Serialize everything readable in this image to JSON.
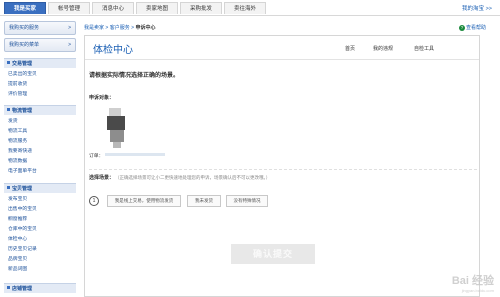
{
  "topnav": {
    "tabs": [
      {
        "label": "我是买家",
        "active": true
      },
      {
        "label": "帐号管理",
        "active": false
      },
      {
        "label": "消息中心",
        "active": false
      },
      {
        "label": "卖家地图",
        "active": false
      },
      {
        "label": "采购批发",
        "active": false
      },
      {
        "label": "卖往海外",
        "active": false
      }
    ],
    "mytaobao": "我的淘宝 >>"
  },
  "sidebar": {
    "buttons": [
      {
        "label": "我购买的服务",
        "arrow": ">"
      },
      {
        "label": "我购买的菜单",
        "arrow": ">"
      }
    ],
    "sections": [
      {
        "title": "交易管理",
        "items": [
          "已卖出的宝贝",
          "提前收货",
          "评价管理"
        ]
      },
      {
        "title": "物流管理",
        "items": [
          "发货",
          "物流工具",
          "物流服务",
          "我要寄快递",
          "物流数据",
          "电子面单平台"
        ]
      },
      {
        "title": "宝贝管理",
        "items": [
          "发布宝贝",
          "出售中的宝贝",
          "橱窗推荐",
          "仓库中的宝贝",
          "体检中心",
          "历史宝贝记录",
          "品牌宝贝",
          "新品词图"
        ]
      },
      {
        "title": "店铺管理",
        "items": []
      }
    ]
  },
  "breadcrumb": {
    "items": [
      "我是卖家",
      "客户服务",
      "申诉中心"
    ],
    "separator": ">"
  },
  "help": {
    "icon": "question-circle-icon",
    "label": "查看帮助"
  },
  "panel": {
    "title": "体检中心",
    "tabs": [
      "首页",
      "我的违规",
      "自检工具"
    ]
  },
  "instruction": "请根据实际情况选择正确的场景。",
  "appeal_target_label": "申诉对象：",
  "order_label": "订单：",
  "scene": {
    "label": "选择场景：",
    "note": "（正确选择场景可让小二更快速地处理您的申诉，场景确认后不可以更改哦。）",
    "step": "1",
    "options": [
      "我是线上交易，使用物流发货",
      "我未发货",
      "没有特殊情况"
    ]
  },
  "submit_label": "确认提交",
  "watermark": {
    "main": "Bai 经验",
    "sub": "jingyan.baidu.com"
  },
  "colors": {
    "accent_blue": "#3a6fc0",
    "link_blue": "#1a5fb4",
    "help_green": "#1a8a3c"
  }
}
